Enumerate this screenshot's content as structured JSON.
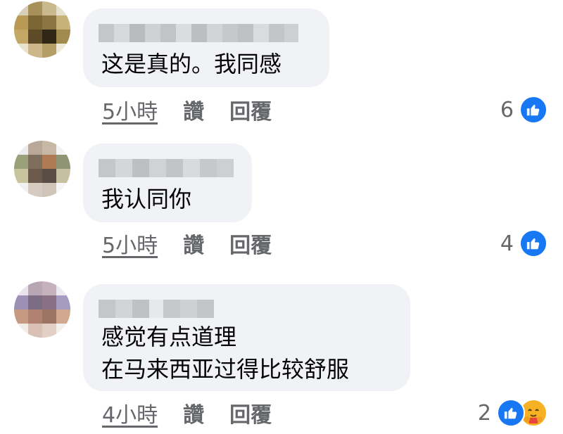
{
  "comments": [
    {
      "text": "这是真的。我同感",
      "time": "5小時",
      "like_label": "讚",
      "reply_label": "回覆",
      "reaction_count": "6",
      "reactions": [
        "like-icon"
      ]
    },
    {
      "text": "我认同你",
      "time": "5小時",
      "like_label": "讚",
      "reply_label": "回覆",
      "reaction_count": "4",
      "reactions": [
        "like-icon"
      ]
    },
    {
      "text": "感觉有点道理\n在马来西亚过得比较舒服",
      "time": "4小時",
      "like_label": "讚",
      "reply_label": "回覆",
      "reaction_count": "2",
      "reactions": [
        "like-icon",
        "care-icon"
      ]
    }
  ],
  "colors": {
    "bubble": "#f0f2f5",
    "text": "#050505",
    "meta": "#65676b",
    "like_blue": "#1877f2",
    "care_yellow": "#f7b125"
  }
}
